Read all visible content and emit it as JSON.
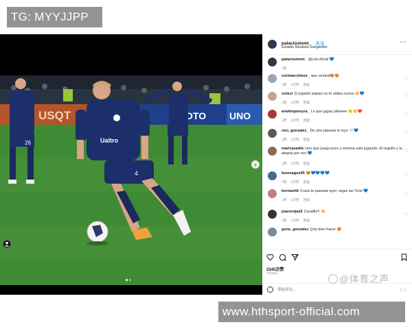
{
  "overlay": {
    "tg_label": "TG: MYYJJPP",
    "site_label": "www.hthsport-official.com",
    "watermark": "@体育之声"
  },
  "header": {
    "username": "palaciostomi_",
    "follow_label": "· 关注",
    "location": "Estadio Bautista Gargantini",
    "more_icon": "more-icon"
  },
  "comments": [
    {
      "user": "palaciostomi_",
      "text": "@csir.oficial 💙",
      "time": "1周",
      "likes": "",
      "reply": ""
    },
    {
      "user": "corimacchioor_",
      "text": "que central😍😍",
      "time": "1周",
      "likes": "3次赞",
      "reply": "回复"
    },
    {
      "user": "octa.ir",
      "text": "Q jugador papaa no te vallas nunca 👏💙",
      "time": "1周",
      "likes": "2次赞",
      "reply": "回复"
    },
    {
      "user": "erwinnpereyra_",
      "text": "Lo que jugas pibeeee 👏👏❤️",
      "time": "1周",
      "likes": "2次赞",
      "reply": "回复"
    },
    {
      "user": "roci_gonzalez_",
      "text": "De otro planeta lo tuyo 🤍💙",
      "time": "1周",
      "likes": "1次赞",
      "reply": "回复"
    },
    {
      "user": "maricasadio",
      "text": "Uno que juega poco y encima sale jugando. El orgullo y la alegria por vos 💙",
      "time": "1周",
      "likes": "1次赞",
      "reply": "回复"
    },
    {
      "user": "funesagus05",
      "text": "😍💙💙💙💙",
      "time": "1周",
      "likes": "5次赞",
      "reply": "回复"
    },
    {
      "user": "hernanh6",
      "text": "Crack te pasaste ayer. segui asi Tomi 💙",
      "time": "1周",
      "likes": "1次赞",
      "reply": "回复"
    },
    {
      "user": "joacorojas5",
      "text": "Caudillo!! 👏",
      "time": "1周",
      "likes": "1次赞",
      "reply": "回复"
    },
    {
      "user": "gone_gonzalez",
      "text": "Que bien hacer 😍",
      "time": "",
      "likes": "",
      "reply": ""
    }
  ],
  "actions": {
    "likes": "2345次赞",
    "date": "7月28日",
    "comment_placeholder": "添加评论...",
    "post_label": "发布"
  },
  "colors": {
    "accent": "#0095f6",
    "kit_navy": "#1c2f6b",
    "pitch_green": "#3f8a34"
  }
}
